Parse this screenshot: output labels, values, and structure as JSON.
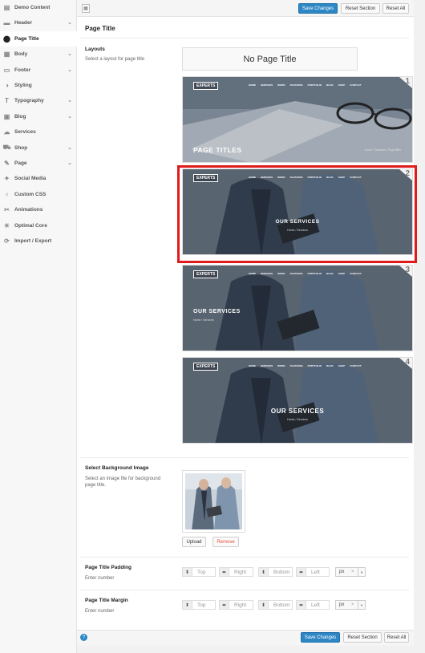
{
  "sidebar": {
    "items": [
      {
        "label": "Demo Content",
        "icon": "download-icon",
        "glyph": "▤",
        "chev": false
      },
      {
        "label": "Header",
        "icon": "header-icon",
        "glyph": "▬",
        "chev": true
      },
      {
        "label": "Page Title",
        "icon": "map-pin-icon",
        "glyph": "⬤",
        "chev": false,
        "active": true
      },
      {
        "label": "Body",
        "icon": "body-icon",
        "glyph": "▦",
        "chev": true
      },
      {
        "label": "Footer",
        "icon": "footer-icon",
        "glyph": "▭",
        "chev": true
      },
      {
        "label": "Styling",
        "icon": "contrast-icon",
        "glyph": "◑",
        "chev": false
      },
      {
        "label": "Typography",
        "icon": "text-icon",
        "glyph": "T",
        "chev": true
      },
      {
        "label": "Blog",
        "icon": "blog-icon",
        "glyph": "▣",
        "chev": true
      },
      {
        "label": "Services",
        "icon": "services-icon",
        "glyph": "☁",
        "chev": false
      },
      {
        "label": "Shop",
        "icon": "cart-icon",
        "glyph": "⛟",
        "chev": true
      },
      {
        "label": "Page",
        "icon": "edit-icon",
        "glyph": "✎",
        "chev": true
      },
      {
        "label": "Social Media",
        "icon": "twitter-icon",
        "glyph": "✦",
        "chev": false
      },
      {
        "label": "Custom CSS",
        "icon": "css-icon",
        "glyph": "♀",
        "chev": false
      },
      {
        "label": "Animations",
        "icon": "animation-icon",
        "glyph": "✂",
        "chev": false
      },
      {
        "label": "Optimal Core",
        "icon": "core-icon",
        "glyph": "☀",
        "chev": false
      },
      {
        "label": "Import / Export",
        "icon": "refresh-icon",
        "glyph": "⟳",
        "chev": false
      }
    ]
  },
  "toolbar": {
    "save_label": "Save Changes",
    "reset_section_label": "Reset Section",
    "reset_all_label": "Reset All"
  },
  "section_title": "Page Title",
  "layouts": {
    "label": "Layouts",
    "desc": "Select a layout for page title",
    "none_label": "No Page Title",
    "thumbs": [
      {
        "num": "1",
        "logo": "EXPERTS",
        "title": "PAGE TITLES",
        "crumbs": "Home  /  Features  /  Page titles"
      },
      {
        "num": "2",
        "logo": "EXPERTS",
        "title": "OUR SERVICES",
        "crumbs": "Home  /  Services"
      },
      {
        "num": "3",
        "logo": "EXPERTS",
        "title": "OUR SERVICES",
        "crumbs": "Home  /  Services"
      },
      {
        "num": "4",
        "logo": "EXPERTS",
        "title": "OUR SERVICES",
        "crumbs": "Home  /  Services"
      }
    ],
    "menu": [
      "HOME",
      "SERVICES",
      "WORK",
      "FEATURES",
      "PORTFOLIO",
      "BLOG",
      "SHOP",
      "CONTACT"
    ]
  },
  "background": {
    "label": "Select Background Image",
    "desc_line1": "Select an image file for background",
    "desc_line2": "page title.",
    "upload_label": "Upload",
    "remove_label": "Remove"
  },
  "padding": {
    "label": "Page Title Padding",
    "desc": "Enter number",
    "top": "Top",
    "right": "Right",
    "bottom": "Bottom",
    "left": "Left",
    "unit": "px"
  },
  "margin": {
    "label": "Page Title Margin",
    "desc": "Enter number",
    "top": "Top",
    "right": "Right",
    "bottom": "Bottom",
    "left": "Left",
    "unit": "px"
  },
  "colors": {
    "accent": "#2e87c5",
    "selection": "#e01b1b"
  }
}
